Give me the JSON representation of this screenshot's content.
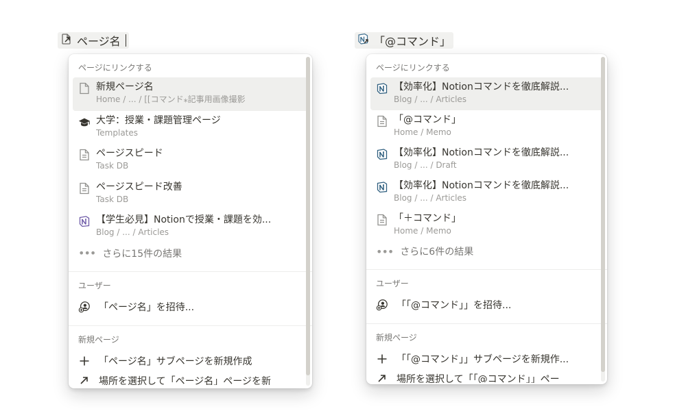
{
  "left": {
    "input_text": "ページ名",
    "section_link": "ページにリンクする",
    "results": [
      {
        "icon": "page-icon",
        "title": "新規ページ名",
        "sub": "Home / ... / [[コマンド⁎記事用画像撮影"
      },
      {
        "icon": "graduation-cap-icon",
        "title": "大学：授業・課題管理ページ",
        "sub": "Templates"
      },
      {
        "icon": "document-icon",
        "title": "ページスピード",
        "sub": "Task DB"
      },
      {
        "icon": "document-icon",
        "title": "ページスピード改善",
        "sub": "Task DB"
      },
      {
        "icon": "notion-logo-icon",
        "title": "【学生必見】Notionで授業・課題を効...",
        "sub": "Blog / ... / Articles"
      }
    ],
    "more_results": "さらに15件の結果",
    "section_user": "ユーザー",
    "invite_label": "「ページ名」を招待...",
    "section_new": "新規ページ",
    "create_subpage_label": "「ページ名」サブページを新規作成",
    "create_elsewhere_label": "場所を選択して「ページ名」ページを新"
  },
  "right": {
    "input_text": "「@コマンド」",
    "section_link": "ページにリンクする",
    "results": [
      {
        "icon": "notion-logo-icon",
        "title": "【効率化】Notionコマンドを徹底解説...",
        "sub": "Blog / ... / Articles"
      },
      {
        "icon": "document-icon",
        "title": "「@コマンド」",
        "sub": "Home / Memo"
      },
      {
        "icon": "notion-logo-icon",
        "title": "【効率化】Notionコマンドを徹底解説...",
        "sub": "Blog / ... / Draft"
      },
      {
        "icon": "notion-logo-icon",
        "title": "【効率化】Notionコマンドを徹底解説...",
        "sub": "Blog / ... / Articles"
      },
      {
        "icon": "document-icon",
        "title": "「＋コマンド」",
        "sub": "Home / Memo"
      }
    ],
    "more_results": "さらに6件の結果",
    "section_user": "ユーザー",
    "invite_label": "「「@コマンド」」を招待...",
    "section_new": "新規ページ",
    "create_subpage_label": "「「@コマンド」」サブページを新規作...",
    "create_elsewhere_label": "場所を選択して「「@コマンド」」ペー"
  }
}
